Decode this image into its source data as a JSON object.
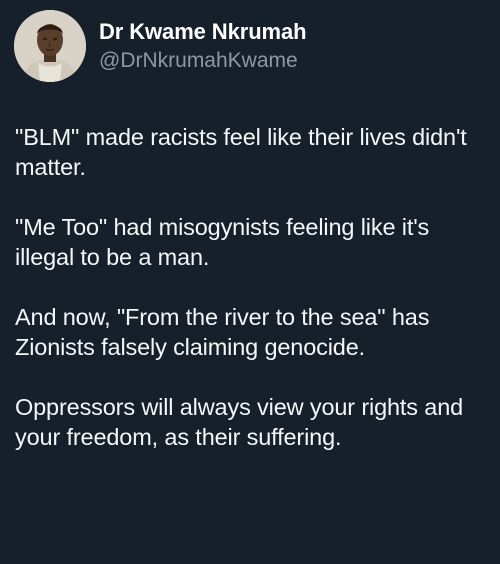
{
  "author": {
    "display_name": "Dr Kwame Nkrumah",
    "handle": "@DrNkrumahKwame"
  },
  "tweet": {
    "paragraphs": [
      "\"BLM\" made racists feel like their lives didn't matter.",
      "\"Me Too\" had misogynists feeling like it's illegal to be a man.",
      "And now, \"From the river to the sea\" has Zionists falsely claiming genocide.",
      "Oppressors will always view your rights and your freedom, as their suffering."
    ]
  },
  "colors": {
    "background": "#15202b",
    "text": "#ffffff",
    "handle": "#8b98a5"
  }
}
